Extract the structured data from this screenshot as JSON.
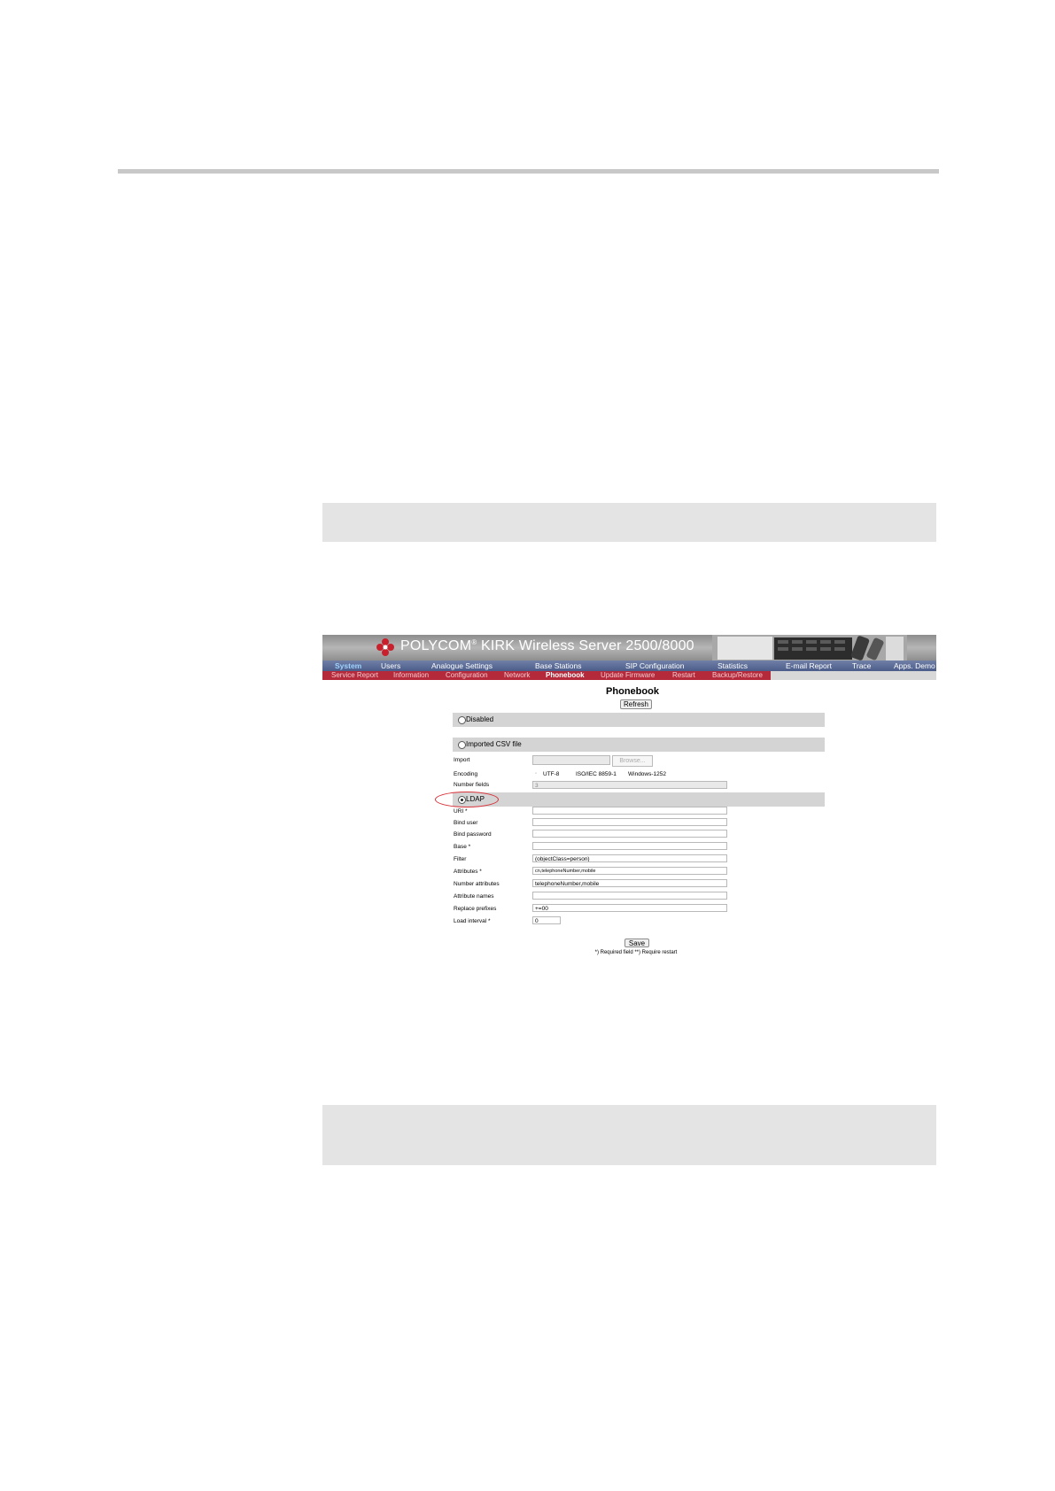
{
  "banner": {
    "brand": "POLYCOM",
    "reg": "®",
    "title": "KIRK Wireless Server 2500/8000"
  },
  "main_menu": [
    "System",
    "Users",
    "Analogue Settings",
    "Base Stations",
    "SIP Configuration",
    "Statistics",
    "E-mail Report",
    "Trace",
    "Apps. Demo"
  ],
  "main_menu_active": "System",
  "sub_menu": [
    "Service Report",
    "Information",
    "Configuration",
    "Network",
    "Phonebook",
    "Update Firmware",
    "Restart",
    "Backup/Restore"
  ],
  "sub_menu_active": "Phonebook",
  "page": {
    "title": "Phonebook",
    "refresh_label": "Refresh"
  },
  "sources": {
    "disabled_label": "Disabled",
    "csv_label": "Imported CSV file",
    "ldap_label": "LDAP",
    "selected": "LDAP"
  },
  "csv": {
    "import_label": "Import",
    "browse_label": "Browse...",
    "encoding_label": "Encoding",
    "encodings": [
      "UTF-8",
      "ISO/IEC 8859-1",
      "Windows-1252"
    ],
    "number_fields_label": "Number fields",
    "number_fields_value": "3"
  },
  "ldap": {
    "fields": [
      {
        "label": "URI *",
        "value": ""
      },
      {
        "label": "Bind user",
        "value": ""
      },
      {
        "label": "Bind password",
        "value": ""
      },
      {
        "label": "Base *",
        "value": ""
      },
      {
        "label": "Filter",
        "value": "(objectClass=person)"
      },
      {
        "label": "Attributes *",
        "value": "cn,telephoneNumber,mobile"
      },
      {
        "label": "Number attributes",
        "value": "telephoneNumber,mobile"
      },
      {
        "label": "Attribute names",
        "value": ""
      },
      {
        "label": "Replace prefixes",
        "value": "+=00"
      },
      {
        "label": "Load interval *",
        "value": "0"
      }
    ]
  },
  "save_label": "Save",
  "required_note": "*) Required field **) Require restart",
  "colors": {
    "banner": "#9a9a9a",
    "menu_main": "#5a6b96",
    "menu_sub": "#b52a3a",
    "section": "#d4d4d4",
    "highlight": "#d8323a"
  }
}
